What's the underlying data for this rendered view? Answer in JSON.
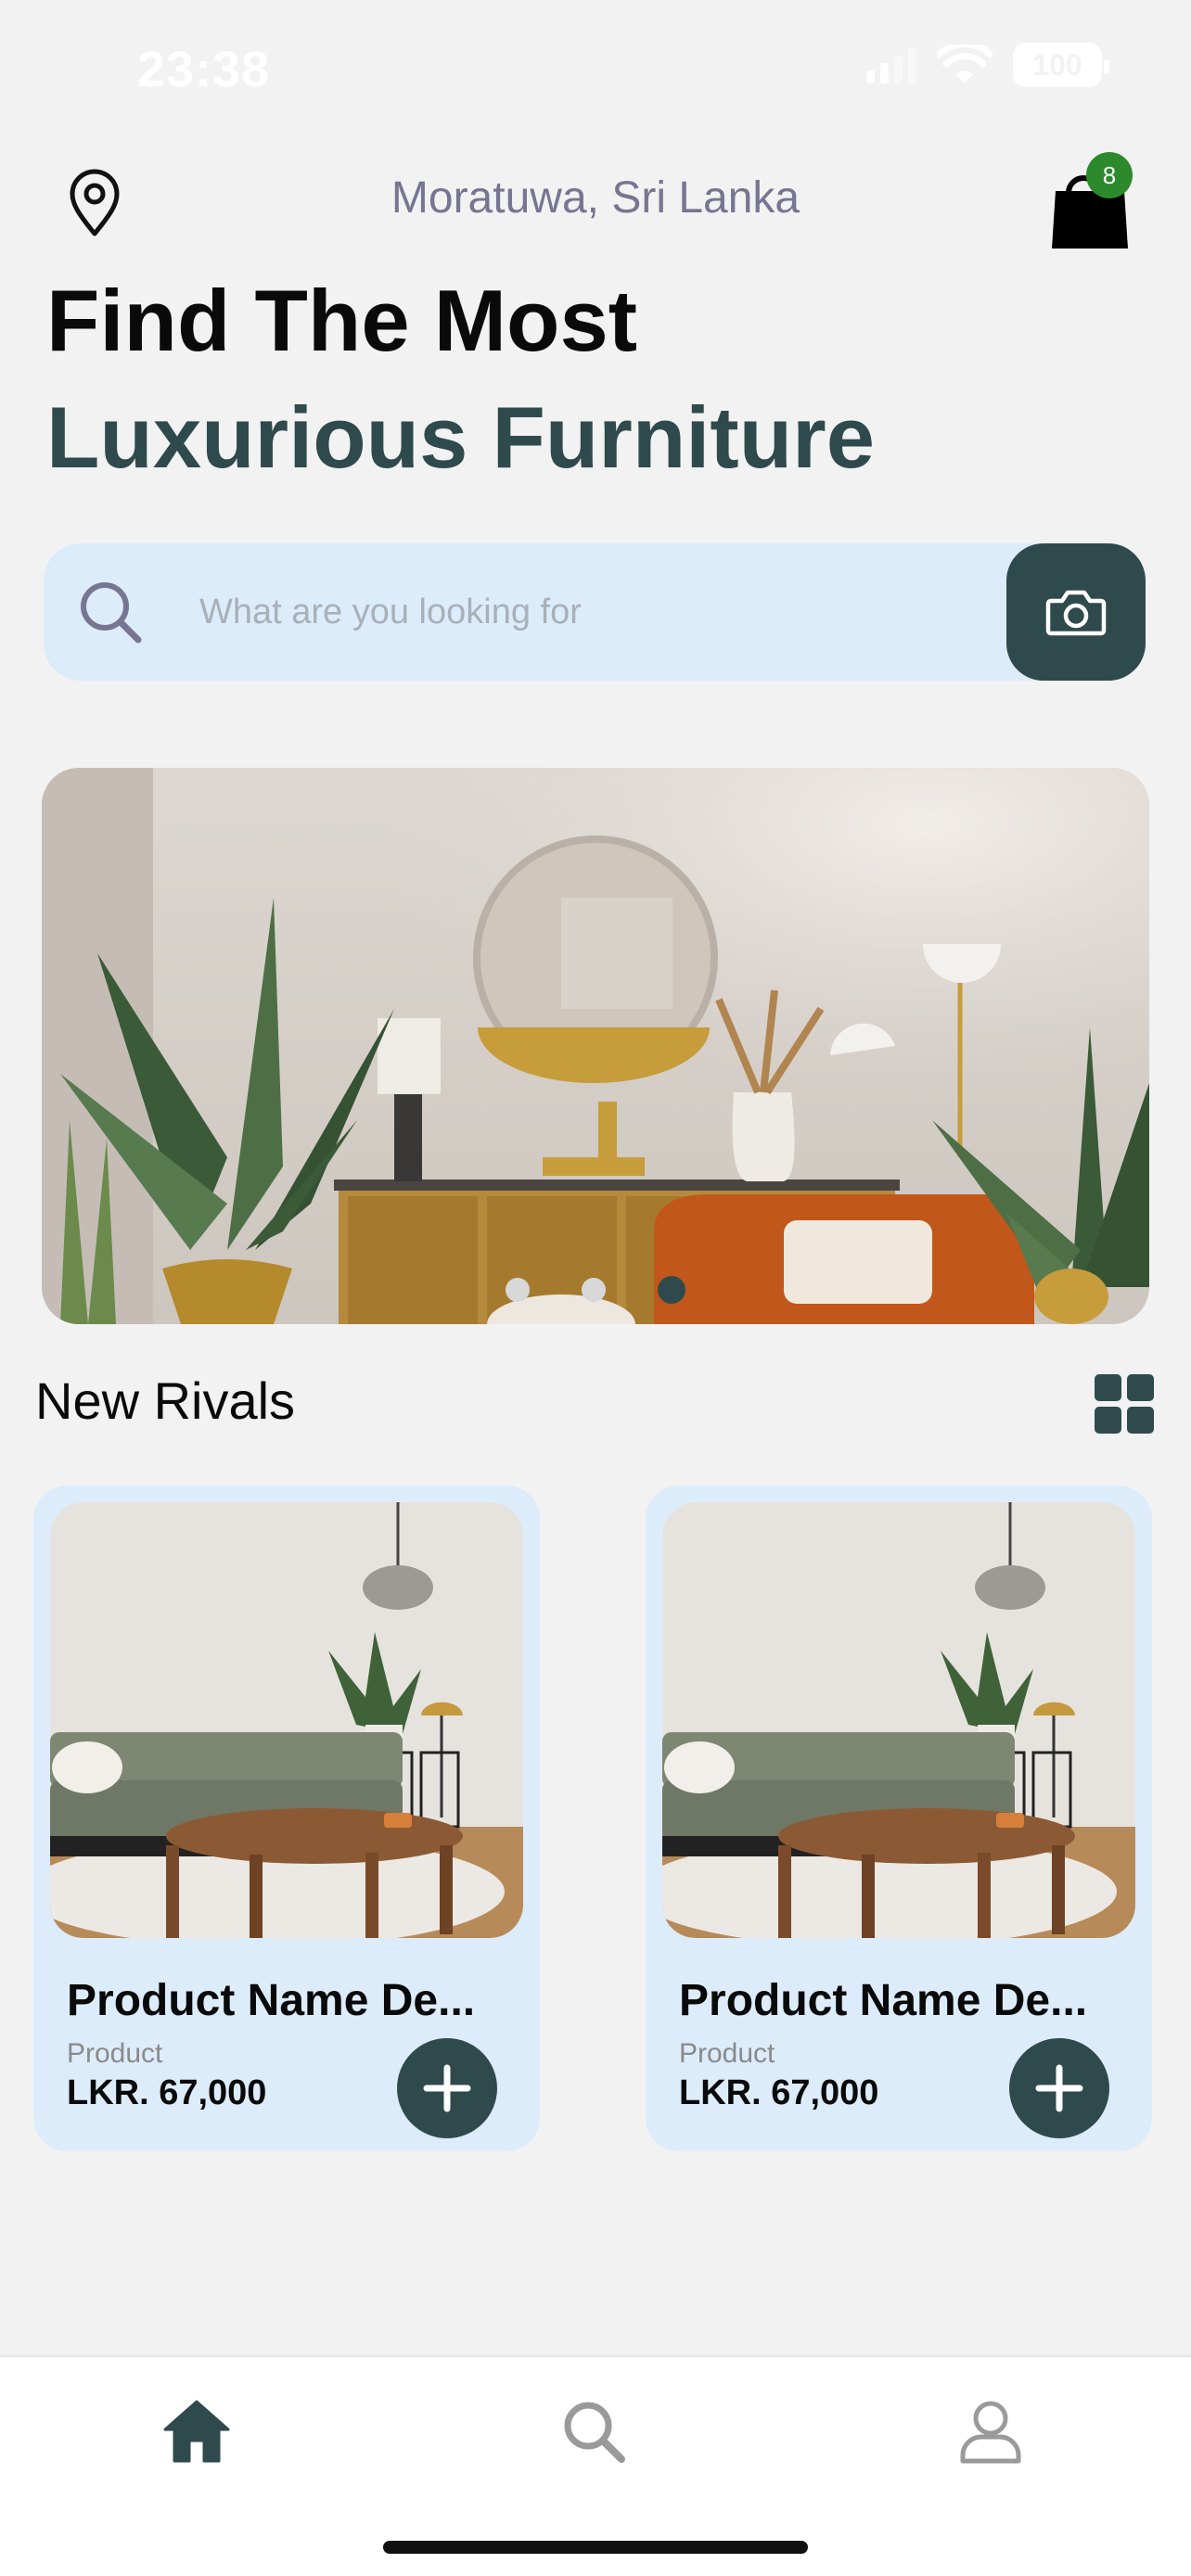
{
  "status_bar": {
    "time": "23:38",
    "battery": "100",
    "icons": [
      "signal-icon",
      "wifi-icon",
      "battery-icon"
    ]
  },
  "header": {
    "location_icon": "map-pin-icon",
    "location": "Moratuwa, Sri Lanka",
    "cart_icon": "shopping-bag-icon",
    "cart_count": "8"
  },
  "headline": {
    "line1": "Find The Most",
    "line2": "Luxurious Furniture"
  },
  "search": {
    "placeholder": "What are you looking for",
    "value": "",
    "camera_icon": "camera-icon"
  },
  "banner": {
    "slides": 3,
    "active_slide": 3
  },
  "section": {
    "title": "New Rivals",
    "view_toggle_icon": "grid-view-icon"
  },
  "products": [
    {
      "name": "Product Name De...",
      "category": "Product",
      "price": "LKR. 67,000"
    },
    {
      "name": "Product Name De...",
      "category": "Product",
      "price": "LKR. 67,000"
    }
  ],
  "nav": {
    "items": [
      "home-icon",
      "search-icon",
      "profile-icon"
    ],
    "active": "home-icon"
  },
  "colors": {
    "primary": "#2f4a4c",
    "card_bg": "#ddecfb",
    "badge": "#2c8a2c",
    "location_text": "#787592",
    "page_bg": "#f2f2f2"
  }
}
